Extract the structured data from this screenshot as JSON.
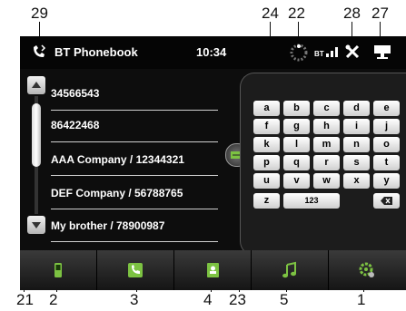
{
  "callouts": {
    "top": [
      "29",
      "24",
      "22",
      "28",
      "27"
    ],
    "bottom": [
      "21",
      "2",
      "3",
      "4",
      "23",
      "5",
      "1"
    ]
  },
  "status": {
    "title": "BT Phonebook",
    "time": "10:34",
    "bt_label": "BT"
  },
  "contacts": [
    "34566543",
    "86422468",
    "AAA Company / 12344321",
    "DEF Company / 56788765",
    "My brother / 78900987"
  ],
  "keyboard": {
    "rows": [
      [
        "a",
        "b",
        "c",
        "d",
        "e"
      ],
      [
        "f",
        "g",
        "h",
        "i",
        "j"
      ],
      [
        "k",
        "l",
        "m",
        "n",
        "o"
      ],
      [
        "p",
        "q",
        "r",
        "s",
        "t"
      ],
      [
        "u",
        "v",
        "w",
        "x",
        "y"
      ]
    ],
    "z_key": "z",
    "num_key": "123"
  },
  "tabs": [
    "phone-icon",
    "dial-icon",
    "phonebook-icon",
    "music-icon",
    "settings-icon"
  ],
  "colors": {
    "screen": "#0d0d0d",
    "accent_green": "#7cc242",
    "key": "#e8e8e8"
  }
}
